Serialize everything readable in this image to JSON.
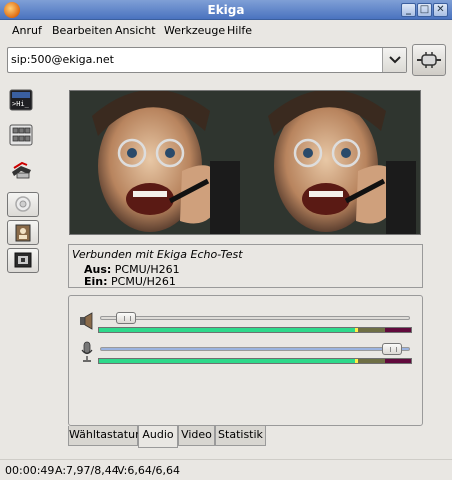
{
  "window": {
    "title": "Ekiga"
  },
  "menu": [
    "Anruf",
    "Bearbeiten",
    "Ansicht",
    "Werkzeuge",
    "Hilfe"
  ],
  "url": {
    "value": "sip:500@ekiga.net"
  },
  "sidebar": {
    "items": [
      "text-chat-icon",
      "dialpad-icon",
      "phone-hangup-icon",
      "webcam-icon",
      "address-book-icon",
      "video-settings-icon"
    ],
    "chat_badge": ">Hi_"
  },
  "status": {
    "connected": "Verbunden mit Ekiga Echo-Test",
    "out_label": "Aus:",
    "out_codecs": "PCMU/H261",
    "in_label": "Ein:",
    "in_codecs": "PCMU/H261"
  },
  "audio": {
    "speaker_volume": 0.05,
    "mic_volume": 0.97,
    "speaker_level": 0.82,
    "mic_level": 0.82
  },
  "tabs": [
    "Wähltastatur",
    "Audio",
    "Video",
    "Statistik"
  ],
  "active_tab": "Audio",
  "statusbar": {
    "time": "00:00:49",
    "audio": "A:7,97/8,44",
    "video": "V:6,64/6,64"
  },
  "colors": {
    "accent": "#4a73bf",
    "vu_fill": "#2ed98b",
    "vu_bg": "#610a3c"
  }
}
